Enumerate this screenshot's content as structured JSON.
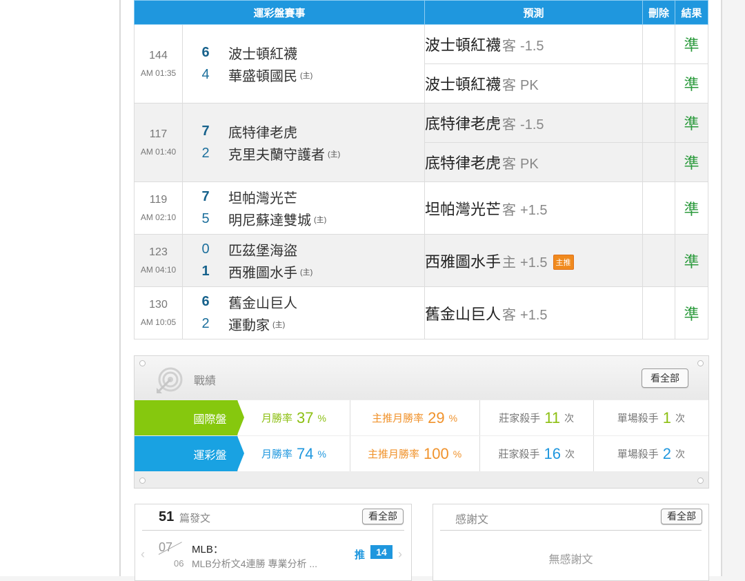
{
  "table": {
    "headers": [
      "運彩盤賽事",
      "預測",
      "刪除",
      "結果"
    ],
    "games": [
      {
        "num": "144",
        "time": "AM 01:35",
        "away": {
          "score": "6",
          "name": "波士頓紅襪"
        },
        "home": {
          "score": "4",
          "name": "華盛頓國民"
        },
        "host_mark": "(主)",
        "picks": [
          {
            "team": "波士頓紅襪",
            "side": "客",
            "line": "-1.5",
            "result": "準"
          },
          {
            "team": "波士頓紅襪",
            "side": "客",
            "line": "PK",
            "result": "準"
          }
        ]
      },
      {
        "num": "117",
        "time": "AM 01:40",
        "away": {
          "score": "7",
          "name": "底特律老虎"
        },
        "home": {
          "score": "2",
          "name": "克里夫蘭守護者"
        },
        "host_mark": "(主)",
        "picks": [
          {
            "team": "底特律老虎",
            "side": "客",
            "line": "-1.5",
            "result": "準"
          },
          {
            "team": "底特律老虎",
            "side": "客",
            "line": "PK",
            "result": "準"
          }
        ]
      },
      {
        "num": "119",
        "time": "AM 02:10",
        "away": {
          "score": "7",
          "name": "坦帕灣光芒"
        },
        "home": {
          "score": "5",
          "name": "明尼蘇達雙城"
        },
        "host_mark": "(主)",
        "picks": [
          {
            "team": "坦帕灣光芒",
            "side": "客",
            "line": "+1.5",
            "result": "準"
          }
        ]
      },
      {
        "num": "123",
        "time": "AM 04:10",
        "away": {
          "score": "0",
          "name": "匹茲堡海盜"
        },
        "home": {
          "score": "1",
          "name": "西雅圖水手"
        },
        "host_mark": "(主)",
        "picks": [
          {
            "team": "西雅圖水手",
            "side": "主",
            "line": "+1.5",
            "badge": "主推",
            "result": "準"
          }
        ]
      },
      {
        "num": "130",
        "time": "AM 10:05",
        "away": {
          "score": "6",
          "name": "舊金山巨人"
        },
        "home": {
          "score": "2",
          "name": "運動家"
        },
        "host_mark": "(主)",
        "picks": [
          {
            "team": "舊金山巨人",
            "side": "客",
            "line": "+1.5",
            "result": "準"
          }
        ]
      }
    ]
  },
  "record": {
    "title": "戰績",
    "view_all": "看全部",
    "rows": [
      {
        "label": "國際盤",
        "month_rate_label": "月勝率",
        "month_rate": "37",
        "main_rate_label": "主推月勝率",
        "main_rate": "29",
        "pct": "%",
        "banker_label": "莊家殺手",
        "banker": "11",
        "single_label": "單場殺手",
        "single": "1",
        "times": "次"
      },
      {
        "label": "運彩盤",
        "month_rate_label": "月勝率",
        "month_rate": "74",
        "main_rate_label": "主推月勝率",
        "main_rate": "100",
        "pct": "%",
        "banker_label": "莊家殺手",
        "banker": "16",
        "single_label": "單場殺手",
        "single": "2",
        "times": "次"
      }
    ]
  },
  "posts": {
    "count": "51",
    "count_label": "篇發文",
    "view_all": "看全部",
    "item": {
      "month": "07",
      "day": "06",
      "title": "MLB：",
      "desc": "MLB分析文4連勝 專業分析 ...",
      "push_label": "推",
      "push_count": "14"
    }
  },
  "thanks": {
    "title": "感謝文",
    "view_all": "看全部",
    "empty": "無感謝文"
  },
  "colors": {
    "header_blue": "#1f97de",
    "green": "#86c80e",
    "orange": "#f0922b",
    "result_green": "#2b9a3c"
  },
  "icons": {
    "record": "target-arrow-icon",
    "prev": "chevron-left-icon",
    "next": "chevron-right-icon"
  }
}
